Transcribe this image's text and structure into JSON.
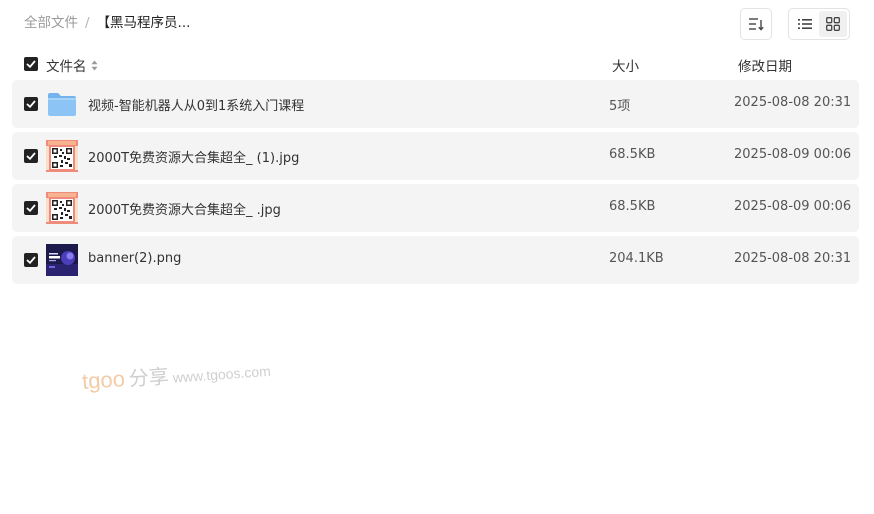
{
  "breadcrumb": {
    "root": "全部文件",
    "separator": "/",
    "current": "【黑马程序员..."
  },
  "toolbar": {
    "sort_icon": "sort-icon",
    "list_view_icon": "list-view-icon",
    "grid_view_icon": "grid-view-icon",
    "active_view": "grid"
  },
  "columns": {
    "name": "文件名",
    "size": "大小",
    "date": "修改日期"
  },
  "files": [
    {
      "name": "视频-智能机器人从0到1系统入门课程",
      "size": "5项",
      "date": "2025-08-08 20:31",
      "type": "folder",
      "checked": true
    },
    {
      "name": "2000T免费资源大合集超全_ (1).jpg",
      "size": "68.5KB",
      "date": "2025-08-09 00:06",
      "type": "image-qr",
      "checked": true
    },
    {
      "name": "2000T免费资源大合集超全_ .jpg",
      "size": "68.5KB",
      "date": "2025-08-09 00:06",
      "type": "image-qr",
      "checked": true
    },
    {
      "name": "banner(2).png",
      "size": "204.1KB",
      "date": "2025-08-08 20:31",
      "type": "image-banner",
      "checked": true
    }
  ],
  "watermark": {
    "brand": "tgoo",
    "cn": "分享",
    "url": "www.tgoos.com"
  },
  "colors": {
    "row_bg": "#f4f4f4",
    "checkbox": "#222222",
    "folder": "#8cc4f5",
    "watermark_brand": "#f3cba5"
  }
}
